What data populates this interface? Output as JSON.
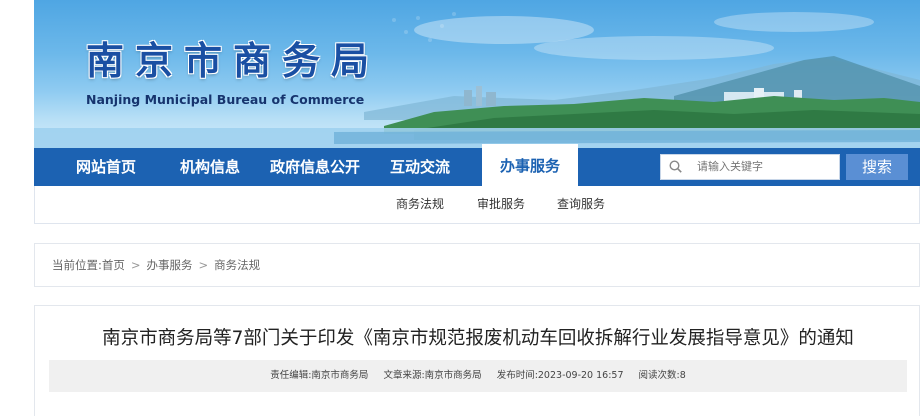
{
  "header": {
    "logo_cn": "南京市商务局",
    "logo_en": "Nanjing Municipal Bureau of Commerce"
  },
  "nav": {
    "items": [
      {
        "label": "网站首页"
      },
      {
        "label": "机构信息"
      },
      {
        "label": "政府信息公开"
      },
      {
        "label": "互动交流"
      },
      {
        "label": "办事服务",
        "active": true
      }
    ],
    "search_placeholder": "请输入关键字",
    "search_button": "搜索"
  },
  "subnav": {
    "items": [
      {
        "label": "商务法规"
      },
      {
        "label": "审批服务"
      },
      {
        "label": "查询服务"
      }
    ]
  },
  "breadcrumb": {
    "prefix": "当前位置:",
    "items": [
      "首页",
      "办事服务",
      "商务法规"
    ],
    "separator": ">"
  },
  "article": {
    "title": "南京市商务局等7部门关于印发《南京市规范报废机动车回收拆解行业发展指导意见》的通知",
    "editor": "责任编辑:南京市商务局",
    "source": "文章来源:南京市商务局",
    "published": "发布时间:2023-09-20 16:57",
    "reads": "阅读次数:8"
  },
  "colors": {
    "nav_blue": "#1c62b2",
    "logo_blue": "#1a4fa3",
    "search_button": "#5a8fd4"
  }
}
